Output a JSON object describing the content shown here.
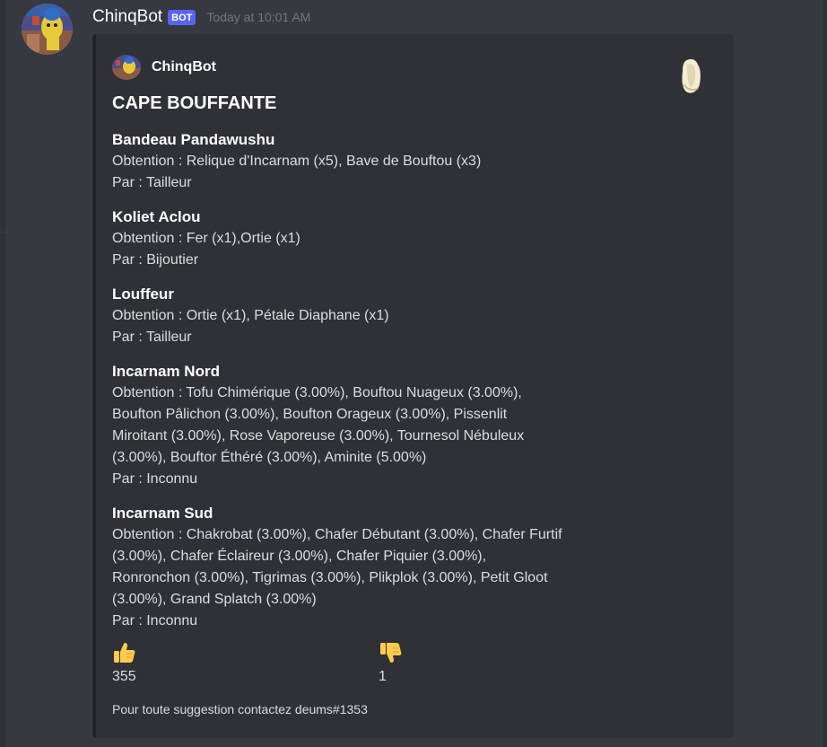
{
  "message": {
    "username": "ChinqBot",
    "bot_tag": "BOT",
    "timestamp": "Today at 10:01 AM",
    "avatar_icon": "avatar-image"
  },
  "embed": {
    "author": "ChinqBot",
    "title": "CAPE BOUFFANTE",
    "thumbnail_icon": "item-thumbnail",
    "fields": [
      {
        "name": "Bandeau Pandawushu",
        "lines": [
          "Obtention : Relique d'Incarnam (x5), Bave de Bouftou (x3)",
          "Par : Tailleur"
        ]
      },
      {
        "name": "Koliet Aclou",
        "lines": [
          "Obtention : Fer (x1),Ortie (x1)",
          "Par : Bijoutier"
        ]
      },
      {
        "name": "Louffeur",
        "lines": [
          "Obtention : Ortie (x1), Pétale Diaphane (x1)",
          "Par : Tailleur"
        ]
      },
      {
        "name": "Incarnam Nord",
        "lines": [
          "Obtention : Tofu Chimérique (3.00%), Bouftou Nuageux (3.00%),",
          "Boufton Pâlichon (3.00%), Boufton Orageux (3.00%), Pissenlit",
          "Miroitant (3.00%), Rose Vaporeuse (3.00%), Tournesol Nébuleux",
          "(3.00%), Bouftor Éthéré (3.00%), Aminite (5.00%)",
          "Par : Inconnu"
        ]
      },
      {
        "name": "Incarnam Sud",
        "lines": [
          "Obtention : Chakrobat (3.00%), Chafer Débutant (3.00%), Chafer Furtif",
          "(3.00%), Chafer Éclaireur (3.00%), Chafer Piquier (3.00%),",
          "Ronronchon (3.00%), Tigrimas (3.00%), Plikplok (3.00%), Petit Gloot",
          "(3.00%), Grand Splatch (3.00%)",
          "Par : Inconnu"
        ]
      }
    ],
    "reactions": [
      {
        "icon": "thumbs-up-icon",
        "count": "355"
      },
      {
        "icon": "thumbs-down-icon",
        "count": "1"
      }
    ],
    "footer": "Pour toute suggestion contactez deums#1353"
  },
  "colors": {
    "background": "#36393f",
    "embed_background": "#2f3136",
    "bot_tag": "#5865f2",
    "timestamp": "#72767d",
    "emoji_yellow": "#ffcc4d"
  }
}
